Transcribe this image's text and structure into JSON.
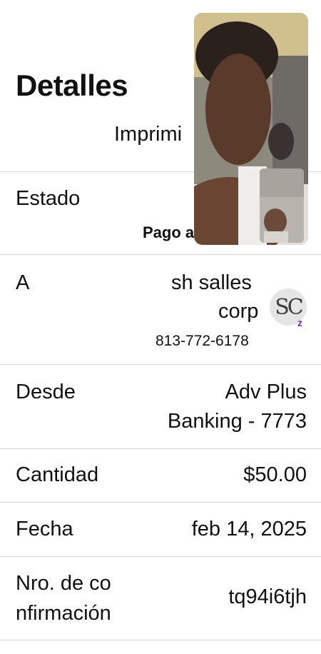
{
  "header": {
    "title": "Detalles",
    "print_link": "Imprimi"
  },
  "estado": {
    "label": "Estado",
    "subtext": "Pago a"
  },
  "recipient": {
    "label": "A",
    "name_line1": "sh salles",
    "name_line2": "corp",
    "phone": "813-772-6178",
    "avatar_initials": "SC",
    "avatar_badge": "z"
  },
  "from": {
    "label": "Desde",
    "line1": "Adv Plus",
    "line2": "Banking - 7773"
  },
  "amount": {
    "label": "Cantidad",
    "value": "$50.00"
  },
  "date": {
    "label": "Fecha",
    "value": "feb 14, 2025"
  },
  "confirmation": {
    "label_line1": "Nro. de co",
    "label_line2": "nfirmación",
    "value": "tq94i6tjh"
  },
  "colors": {
    "text": "#111111",
    "divider": "#d6d6d6",
    "avatar_bg": "#e5e5e5",
    "badge": "#6a2bd0"
  },
  "overlay": {
    "type": "video-call-window",
    "pip_icon": "self-view-camera"
  }
}
